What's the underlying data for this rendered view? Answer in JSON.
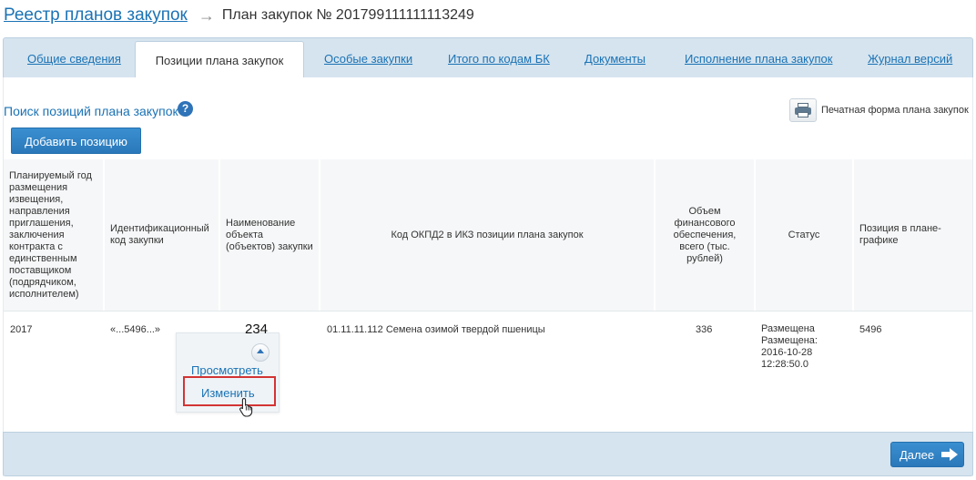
{
  "breadcrumb": {
    "parent_link": "Реестр планов закупок",
    "separator": "→",
    "current": "План закупок № 201799111111113249"
  },
  "tabs": [
    {
      "label": "Общие сведения",
      "active": false
    },
    {
      "label": "Позиции плана закупок",
      "active": true
    },
    {
      "label": "Особые закупки",
      "active": false
    },
    {
      "label": "Итого по кодам БК",
      "active": false
    },
    {
      "label": "Документы",
      "active": false
    },
    {
      "label": "Исполнение плана закупок",
      "active": false
    },
    {
      "label": "Журнал версий",
      "active": false
    }
  ],
  "search": {
    "label": "Поиск позиций плана закупок",
    "help_icon": "?"
  },
  "print": {
    "label": "Печатная форма плана закупок",
    "icon": "printer-icon"
  },
  "add_button": "Добавить позицию",
  "table": {
    "headers": [
      "Планируемый год размещения извещения, направления приглашения, заключения контракта с единственным поставщиком (подрядчиком, исполнителем)",
      "Идентификационный код закупки",
      "Наименование объекта (объектов) закупки",
      "Код ОКПД2 в ИКЗ позиции плана закупок",
      "Объем финансового обеспечения, всего (тыс. рублей)",
      "Статус",
      "Позиция в плане-графике"
    ],
    "row": {
      "year": "2017",
      "code": "«...5496...»",
      "object_number": "234",
      "okpd": "01.11.11.112 Семена озимой твердой пшеницы",
      "amount": "336",
      "status_lines": [
        "Размещена",
        "Размещена:",
        "2016-10-28",
        "12:28:50.0"
      ],
      "schedule_position": "5496"
    }
  },
  "context_menu": {
    "view": "Просмотреть",
    "edit": "Изменить"
  },
  "footer": {
    "next_button": "Далее"
  },
  "colors": {
    "link": "#1b73b5",
    "button": "#2a78ba",
    "tabbar_bg": "#d6e4ef",
    "highlight_border": "#d33434"
  }
}
